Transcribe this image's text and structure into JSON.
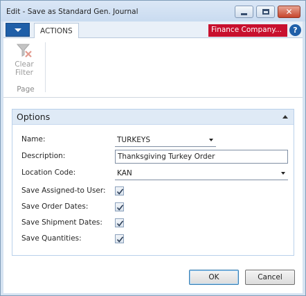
{
  "window": {
    "title": "Edit - Save as Standard Gen. Journal"
  },
  "ribbon": {
    "tab_label": "ACTIONS",
    "company": "Finance Company...",
    "help_glyph": "?",
    "clear_filter_line1": "Clear",
    "clear_filter_line2": "Filter",
    "group_label": "Page"
  },
  "options": {
    "title": "Options",
    "fields": {
      "name": {
        "label": "Name:",
        "value": "TURKEYS"
      },
      "description": {
        "label": "Description:",
        "value": "Thanksgiving Turkey Order"
      },
      "location_code": {
        "label": "Location Code:",
        "value": "KAN"
      }
    },
    "checkboxes": [
      {
        "label": "Save Assigned-to User:",
        "checked": true
      },
      {
        "label": "Save Order Dates:",
        "checked": true
      },
      {
        "label": "Save Shipment Dates:",
        "checked": true
      },
      {
        "label": "Save Quantities:",
        "checked": true
      }
    ]
  },
  "buttons": {
    "ok": "OK",
    "cancel": "Cancel"
  },
  "colors": {
    "accent_blue": "#1f5fa8",
    "company_red": "#c8102e"
  },
  "icons": [
    "dropdown-icon",
    "minimize-icon",
    "maximize-icon",
    "close-icon",
    "help-icon",
    "clear-filter-icon",
    "collapse-icon",
    "dropdown-arrow-icon",
    "checkmark-icon"
  ]
}
